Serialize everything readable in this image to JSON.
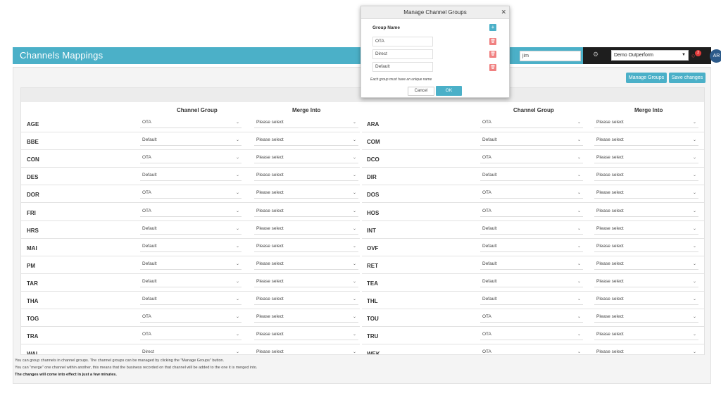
{
  "header": {
    "title": "Channels Mappings",
    "search_value": "jim",
    "hotel_select": "Demo Outperform",
    "notification_count": "3",
    "avatar_initials": "AR"
  },
  "toolbar": {
    "manage_groups_label": "Manage Groups",
    "save_changes_label": "Save changes"
  },
  "columns": {
    "channel_group": "Channel Group",
    "merge_into": "Merge Into"
  },
  "left_rows": [
    {
      "code": "AGE",
      "group": "OTA",
      "merge": "Please select"
    },
    {
      "code": "BBE",
      "group": "Default",
      "merge": "Please select"
    },
    {
      "code": "CON",
      "group": "OTA",
      "merge": "Please select"
    },
    {
      "code": "DES",
      "group": "Default",
      "merge": "Please select"
    },
    {
      "code": "DOR",
      "group": "OTA",
      "merge": "Please select"
    },
    {
      "code": "FRI",
      "group": "OTA",
      "merge": "Please select"
    },
    {
      "code": "HRS",
      "group": "Default",
      "merge": "Please select"
    },
    {
      "code": "MAI",
      "group": "Default",
      "merge": "Please select"
    },
    {
      "code": "PM",
      "group": "Default",
      "merge": "Please select"
    },
    {
      "code": "TAR",
      "group": "Default",
      "merge": "Please select"
    },
    {
      "code": "THA",
      "group": "Default",
      "merge": "Please select"
    },
    {
      "code": "TOG",
      "group": "OTA",
      "merge": "Please select"
    },
    {
      "code": "TRA",
      "group": "OTA",
      "merge": "Please select"
    },
    {
      "code": "WAL",
      "group": "Direct",
      "merge": "Please select"
    }
  ],
  "right_rows": [
    {
      "code": "ARA",
      "group": "OTA",
      "merge": "Please select"
    },
    {
      "code": "COM",
      "group": "Default",
      "merge": "Please select"
    },
    {
      "code": "DCO",
      "group": "OTA",
      "merge": "Please select"
    },
    {
      "code": "DIR",
      "group": "Default",
      "merge": "Please select"
    },
    {
      "code": "DOS",
      "group": "OTA",
      "merge": "Please select"
    },
    {
      "code": "HOS",
      "group": "OTA",
      "merge": "Please select"
    },
    {
      "code": "INT",
      "group": "Default",
      "merge": "Please select"
    },
    {
      "code": "OVF",
      "group": "Default",
      "merge": "Please select"
    },
    {
      "code": "RET",
      "group": "Default",
      "merge": "Please select"
    },
    {
      "code": "TEA",
      "group": "Default",
      "merge": "Please select"
    },
    {
      "code": "THL",
      "group": "Default",
      "merge": "Please select"
    },
    {
      "code": "TOU",
      "group": "OTA",
      "merge": "Please select"
    },
    {
      "code": "TRU",
      "group": "OTA",
      "merge": "Please select"
    },
    {
      "code": "WEK",
      "group": "OTA",
      "merge": "Please select"
    }
  ],
  "footer": {
    "line1": "You can group channels in channel groups. The channel groups can be managed by clicking the \"Manage Groups\" button.",
    "line2": "You can \"merge\" one channel within another, this means that the business recorded on that channel will be added to the one it is merged into.",
    "line3": "The changes will come into effect in just a few minutes."
  },
  "modal": {
    "title": "Manage Channel Groups",
    "group_name_label": "Group Name",
    "groups": [
      "OTA",
      "Direct",
      "Default"
    ],
    "note": "Each group must have an unique name",
    "cancel_label": "Cancel",
    "ok_label": "OK"
  },
  "colors": {
    "accent": "#4bb0c8",
    "dark_bar": "#1e1e1e",
    "delete": "#f08080",
    "badge": "#e23b3b"
  }
}
